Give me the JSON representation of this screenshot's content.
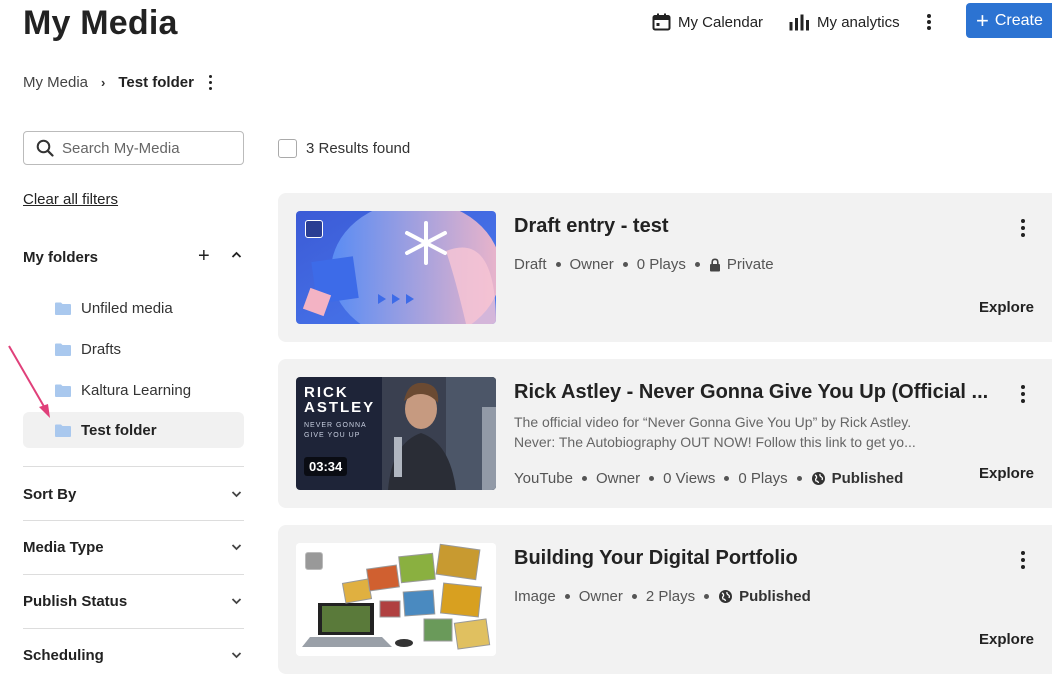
{
  "page": {
    "title": "My Media"
  },
  "header": {
    "calendar_label": "My Calendar",
    "analytics_label": "My analytics",
    "create_label": "Create"
  },
  "breadcrumb": {
    "root": "My Media",
    "current": "Test folder"
  },
  "search": {
    "placeholder": "Search My-Media",
    "value": ""
  },
  "filters": {
    "clear_label": "Clear all filters",
    "folders_heading": "My folders",
    "folders": [
      {
        "label": "Unfiled media",
        "active": false
      },
      {
        "label": "Drafts",
        "active": false
      },
      {
        "label": "Kaltura Learning",
        "active": false
      },
      {
        "label": "Test folder",
        "active": true
      }
    ],
    "sections": [
      {
        "label": "Sort By"
      },
      {
        "label": "Media Type"
      },
      {
        "label": "Publish Status"
      },
      {
        "label": "Scheduling"
      }
    ]
  },
  "results": {
    "count_label": "3 Results found",
    "entries": [
      {
        "title": "Draft entry - test",
        "description": "",
        "meta": [
          "Draft",
          "Owner",
          "0 Plays"
        ],
        "status": "Private",
        "action": "Explore"
      },
      {
        "title": "Rick Astley - Never Gonna Give You Up (Official ...",
        "description_lines": [
          "The official video for “Never Gonna Give You Up” by Rick Astley.",
          "Never: The Autobiography OUT NOW! Follow this link to get yo..."
        ],
        "meta": [
          "YouTube",
          "Owner",
          "0 Views",
          "0 Plays"
        ],
        "status": "Published",
        "duration": "03:34",
        "thumb_text": [
          "RICK",
          "ASTLEY",
          "NEVER GONNA",
          "GIVE YOU UP"
        ],
        "action": "Explore"
      },
      {
        "title": "Building Your Digital Portfolio",
        "description": "",
        "meta": [
          "Image",
          "Owner",
          "2 Plays"
        ],
        "status": "Published",
        "action": "Explore"
      }
    ]
  },
  "colors": {
    "accent": "#2c73d2",
    "card_bg": "#f2f2f2",
    "folder_icon": "#a9c8ee",
    "arrow": "#e0407a"
  }
}
